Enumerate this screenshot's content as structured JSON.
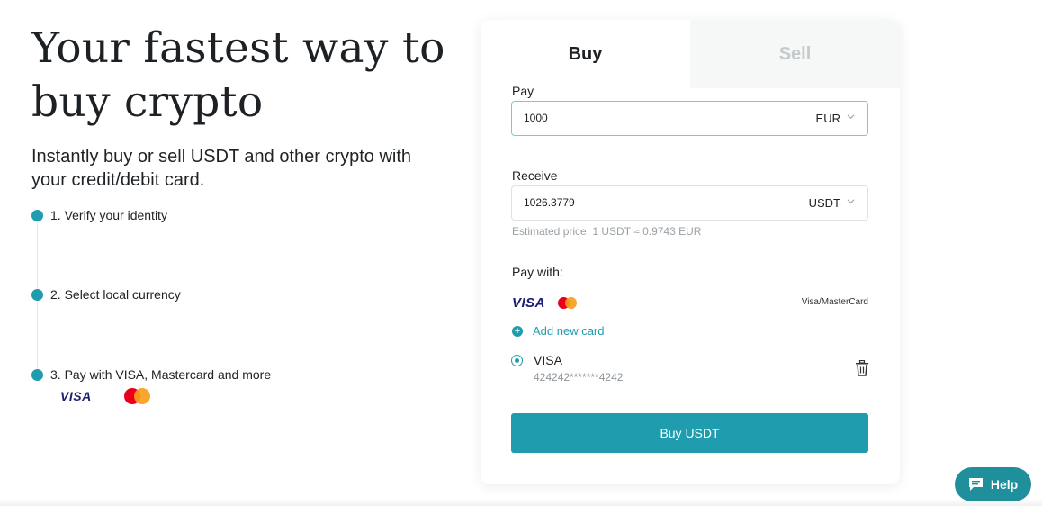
{
  "hero": {
    "title": "Your fastest way to buy crypto",
    "subtitle": "Instantly buy or sell USDT and other crypto with your credit/debit card.",
    "steps": [
      "1. Verify your identity",
      "2. Select local currency",
      "3. Pay with VISA, Mastercard and more"
    ],
    "step_logos": {
      "visa": "VISA",
      "mastercard_icon": "mastercard-icon"
    }
  },
  "widget": {
    "tabs": [
      {
        "label": "Buy",
        "active": true
      },
      {
        "label": "Sell",
        "active": false
      }
    ],
    "pay": {
      "label": "Pay",
      "value": "1000",
      "currency": "EUR"
    },
    "receive": {
      "label": "Receive",
      "value": "1026.3779",
      "currency": "USDT"
    },
    "estimated_price": "Estimated price: 1 USDT ≈ 0.9743 EUR",
    "pay_with": {
      "label": "Pay with:",
      "visa": "VISA",
      "brand_text": "Visa/MasterCard"
    },
    "add_card": "Add new card",
    "saved_card": {
      "name": "VISA",
      "number": "424242*******4242",
      "selected": true
    },
    "buy_button": "Buy USDT"
  },
  "help": {
    "label": "Help"
  },
  "colors": {
    "accent": "#1f9cad",
    "help_bg": "#1f8f9c",
    "tab_inactive_bg": "#f6f8f8"
  }
}
